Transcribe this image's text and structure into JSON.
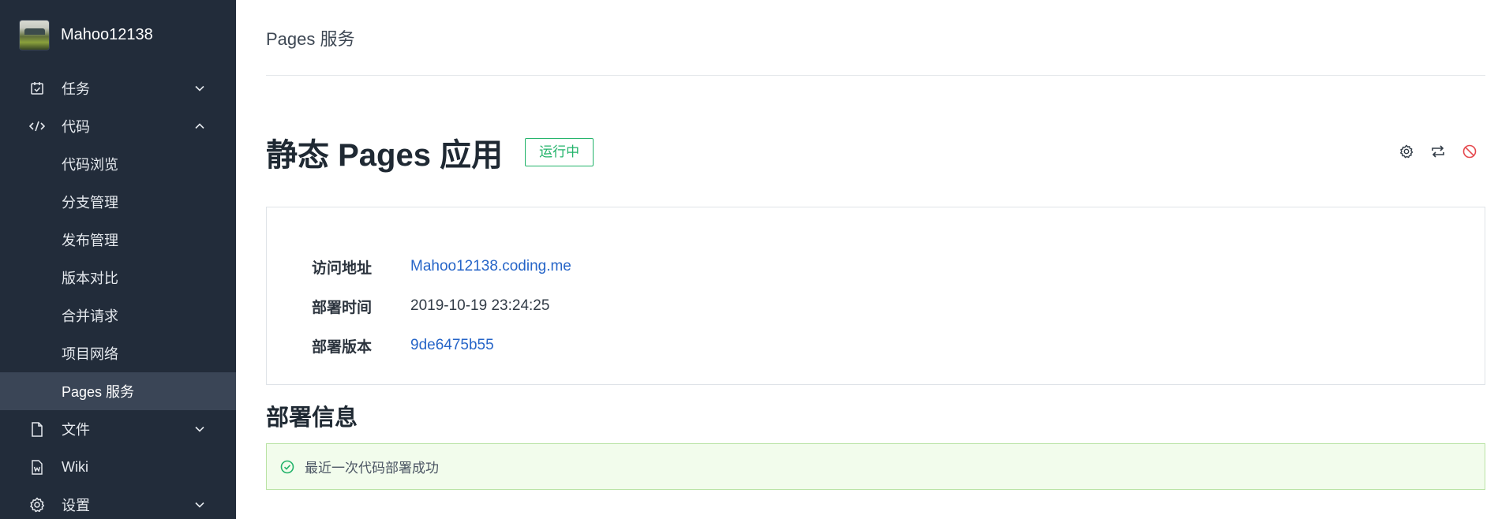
{
  "project": {
    "name": "Mahoo12138"
  },
  "sidebar": {
    "tasks": {
      "label": "任务",
      "icon": "task-check-icon"
    },
    "code": {
      "label": "代码",
      "icon": "code-icon",
      "children": [
        {
          "label": "代码浏览"
        },
        {
          "label": "分支管理"
        },
        {
          "label": "发布管理"
        },
        {
          "label": "版本对比"
        },
        {
          "label": "合并请求"
        },
        {
          "label": "项目网络"
        },
        {
          "label": "Pages 服务"
        }
      ]
    },
    "files": {
      "label": "文件",
      "icon": "file-icon"
    },
    "wiki": {
      "label": "Wiki",
      "icon": "wiki-icon"
    },
    "settings": {
      "label": "设置",
      "icon": "gear-icon"
    }
  },
  "breadcrumb": {
    "title": "Pages 服务"
  },
  "main": {
    "title": "静态 Pages 应用",
    "status": "运行中",
    "status_color": "#22b36a",
    "actions": [
      "gear-icon",
      "redeploy-icon",
      "stop-icon"
    ],
    "info": {
      "url_label": "访问地址",
      "url_value": "Mahoo12138.coding.me",
      "time_label": "部署时间",
      "time_value": "2019-10-19 23:24:25",
      "version_label": "部署版本",
      "version_value": "9de6475b55"
    },
    "deploy_section_title": "部署信息",
    "deploy_message": "最近一次代码部署成功"
  },
  "colors": {
    "sidebar_bg": "#222c3a",
    "sidebar_active": "#3a4556",
    "link": "#2665c8",
    "success": "#22b36a",
    "danger": "#e5484d"
  }
}
